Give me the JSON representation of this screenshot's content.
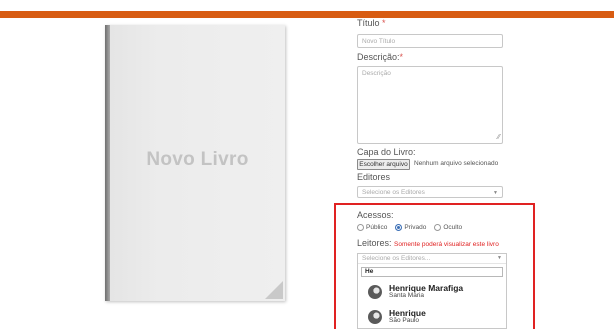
{
  "colors": {
    "topbar": "#d85c12",
    "required": "#d9534f",
    "highlight_box": "#e02222"
  },
  "cover": {
    "title": "Novo Livro"
  },
  "form": {
    "title": {
      "label": "Título",
      "required_mark": "*",
      "placeholder": "Novo Título"
    },
    "description": {
      "label": "Descrição:",
      "required_mark": "*",
      "placeholder": "Descrição"
    },
    "cover": {
      "label": "Capa do Livro:",
      "button": "Escolher arquivo",
      "status": "Nenhum arquivo selecionado"
    },
    "editors": {
      "label": "Editores",
      "placeholder": "Selecione os Editores"
    },
    "access": {
      "label": "Acessos:",
      "options": [
        {
          "label": "Público",
          "selected": false
        },
        {
          "label": "Privado",
          "selected": true
        },
        {
          "label": "Oculto",
          "selected": false
        }
      ]
    },
    "readers": {
      "label": "Leitores:",
      "hint": "Somente poderá visualizar este livro",
      "placeholder": "Selecione os Editores...",
      "search_value": "He",
      "results": [
        {
          "name": "Henrique Marafiga",
          "city": "Santa Maria",
          "avatar_icon": "user-avatar-icon"
        },
        {
          "name": "Henrique",
          "city": "São Paulo",
          "avatar_icon": "user-avatar-icon"
        }
      ]
    }
  }
}
